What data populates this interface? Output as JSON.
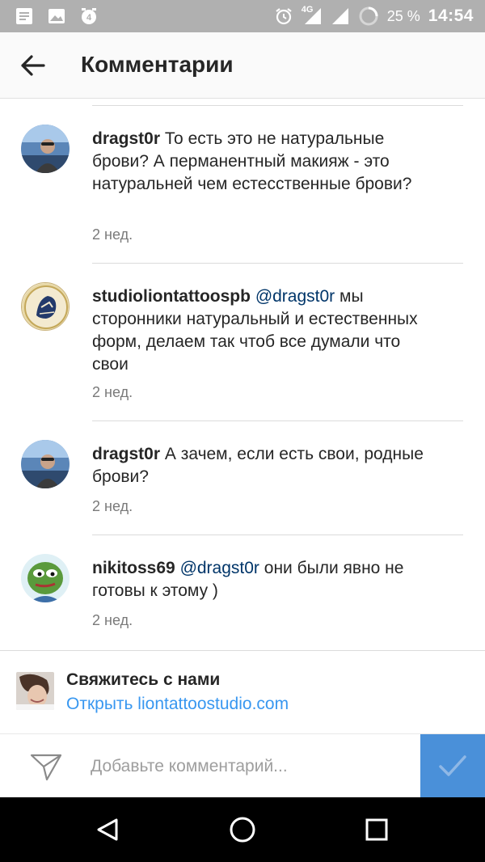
{
  "status_bar": {
    "network": "4G",
    "battery": "25 %",
    "time": "14:54",
    "icons_left": [
      "notification-icon",
      "gallery-icon",
      "alarm-counter-icon"
    ],
    "icons_right": [
      "alarm-icon",
      "signal-icon",
      "wifi-icon",
      "battery-icon"
    ]
  },
  "app_bar": {
    "title": "Комментарии",
    "back_icon": "arrow-left-icon"
  },
  "comments": [
    {
      "username": "dragst0r",
      "mention": "",
      "text": "То есть это не натуральные брови? А перманентный макияж - это натуральней чем естесственные брови?",
      "time": "2 нед."
    },
    {
      "username": "studioliontattoospb",
      "mention": "@dragst0r",
      "text": "мы сторонники натуральный и естественных форм, делаем так чтоб все думали что свои",
      "time": "2 нед."
    },
    {
      "username": "dragst0r",
      "mention": "",
      "text": "А зачем, если есть свои, родные брови?",
      "time": "2 нед."
    },
    {
      "username": "nikitoss69",
      "mention": "@dragst0r",
      "text": "они были явно не готовы к этому )",
      "time": "2 нед."
    }
  ],
  "promo": {
    "title": "Свяжитесь с нами",
    "link": "Открыть liontattoostudio.com"
  },
  "compose": {
    "placeholder": "Добавьте комментарий...",
    "send_icon": "checkmark-icon",
    "compose_icon": "paper-plane-icon"
  },
  "colors": {
    "link": "#3897f0",
    "mention": "#003569",
    "send_button": "#4a90d9",
    "status_bar": "#b0b0b0"
  },
  "nav_bar": {
    "icons": [
      "back-triangle-icon",
      "home-circle-icon",
      "recents-square-icon"
    ]
  }
}
